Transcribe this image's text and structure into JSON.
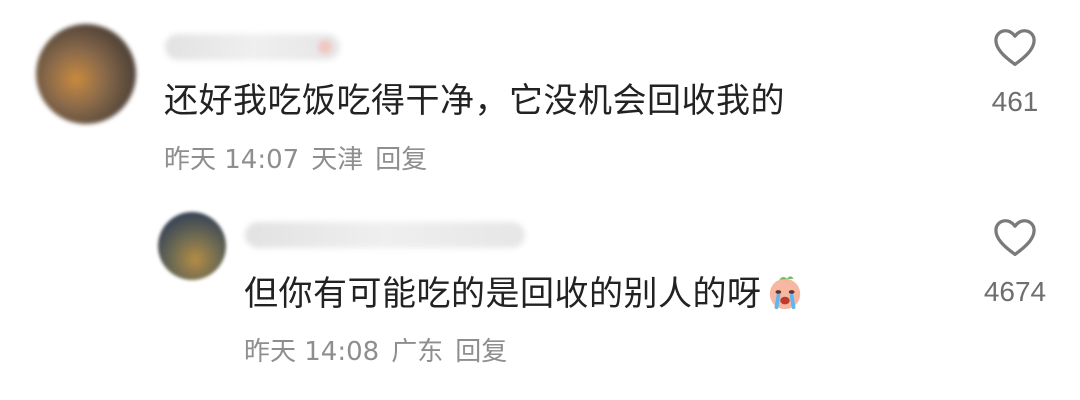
{
  "comments": [
    {
      "text": "还好我吃饭吃得干净，它没机会回收我的",
      "time": "昨天 14:07",
      "location": "天津",
      "reply_label": "回复",
      "likes": "461"
    },
    {
      "text": "但你有可能吃的是回收的别人的呀",
      "emoji": "crying-face-emoji",
      "time": "昨天 14:08",
      "location": "广东",
      "reply_label": "回复",
      "likes": "4674"
    }
  ],
  "icons": {
    "like": "heart-outline-icon"
  },
  "colors": {
    "text": "#222222",
    "meta": "#8e8e8e",
    "likes": "#6e6e6e"
  }
}
